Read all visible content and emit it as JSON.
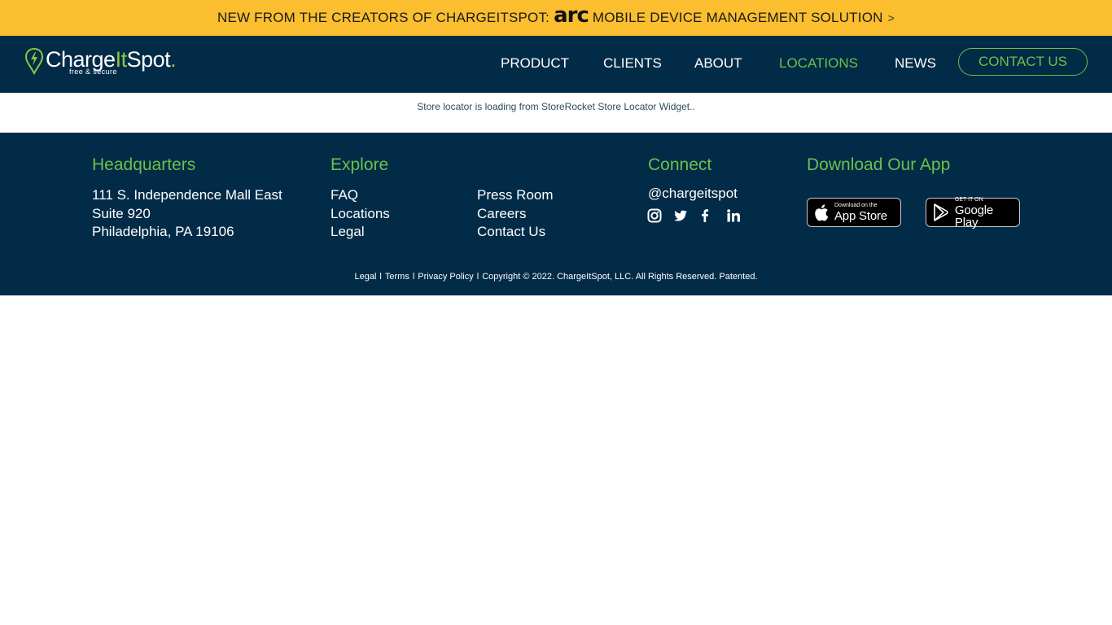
{
  "banner": {
    "text_before": "NEW FROM THE CREATORS OF CHARGEITSPOT:",
    "brand": "arc",
    "text_after": "MOBILE DEVICE MANAGEMENT SOLUTION",
    "chevron": ">"
  },
  "header": {
    "logo": {
      "part1": "Charge",
      "part2": "It",
      "part3": "Spot",
      "dot": ".",
      "tagline": "free & secure"
    },
    "nav": [
      {
        "label": "PRODUCT"
      },
      {
        "label": "CLIENTS"
      },
      {
        "label": "ABOUT"
      },
      {
        "label": "LOCATIONS"
      },
      {
        "label": "NEWS"
      }
    ],
    "contact_label": "CONTACT US",
    "active_color": "#6cc04a"
  },
  "main": {
    "loading_text": "Store locator is loading from StoreRocket Store Locator Widget.."
  },
  "footer": {
    "headquarters": {
      "title": "Headquarters",
      "lines": [
        "111 S. Independence Mall East",
        "Suite 920",
        "Philadelphia, PA 19106"
      ]
    },
    "explore": {
      "title": "Explore",
      "col1": [
        "FAQ",
        "Locations",
        "Legal"
      ],
      "col2": [
        "Press Room",
        "Careers",
        "Contact Us"
      ]
    },
    "connect": {
      "title": "Connect",
      "handle": "@chargeitspot",
      "icons": [
        "instagram-icon",
        "twitter-icon",
        "facebook-icon",
        "linkedin-icon"
      ]
    },
    "app": {
      "title": "Download Our App",
      "appstore_small": "Download on the",
      "appstore_big": "App Store",
      "googleplay_small": "GET IT ON",
      "googleplay_big": "Google Play"
    },
    "bottom": {
      "legal": "Legal",
      "sep": "l",
      "terms": "Terms",
      "privacy": "Privacy Policy",
      "copyright": "Copyright © 2022. ChargeItSpot, LLC. All Rights Reserved. Patented."
    },
    "colors": {
      "background": "#022b47",
      "accent": "#6cc04a",
      "banner": "#fbbe2e"
    }
  }
}
